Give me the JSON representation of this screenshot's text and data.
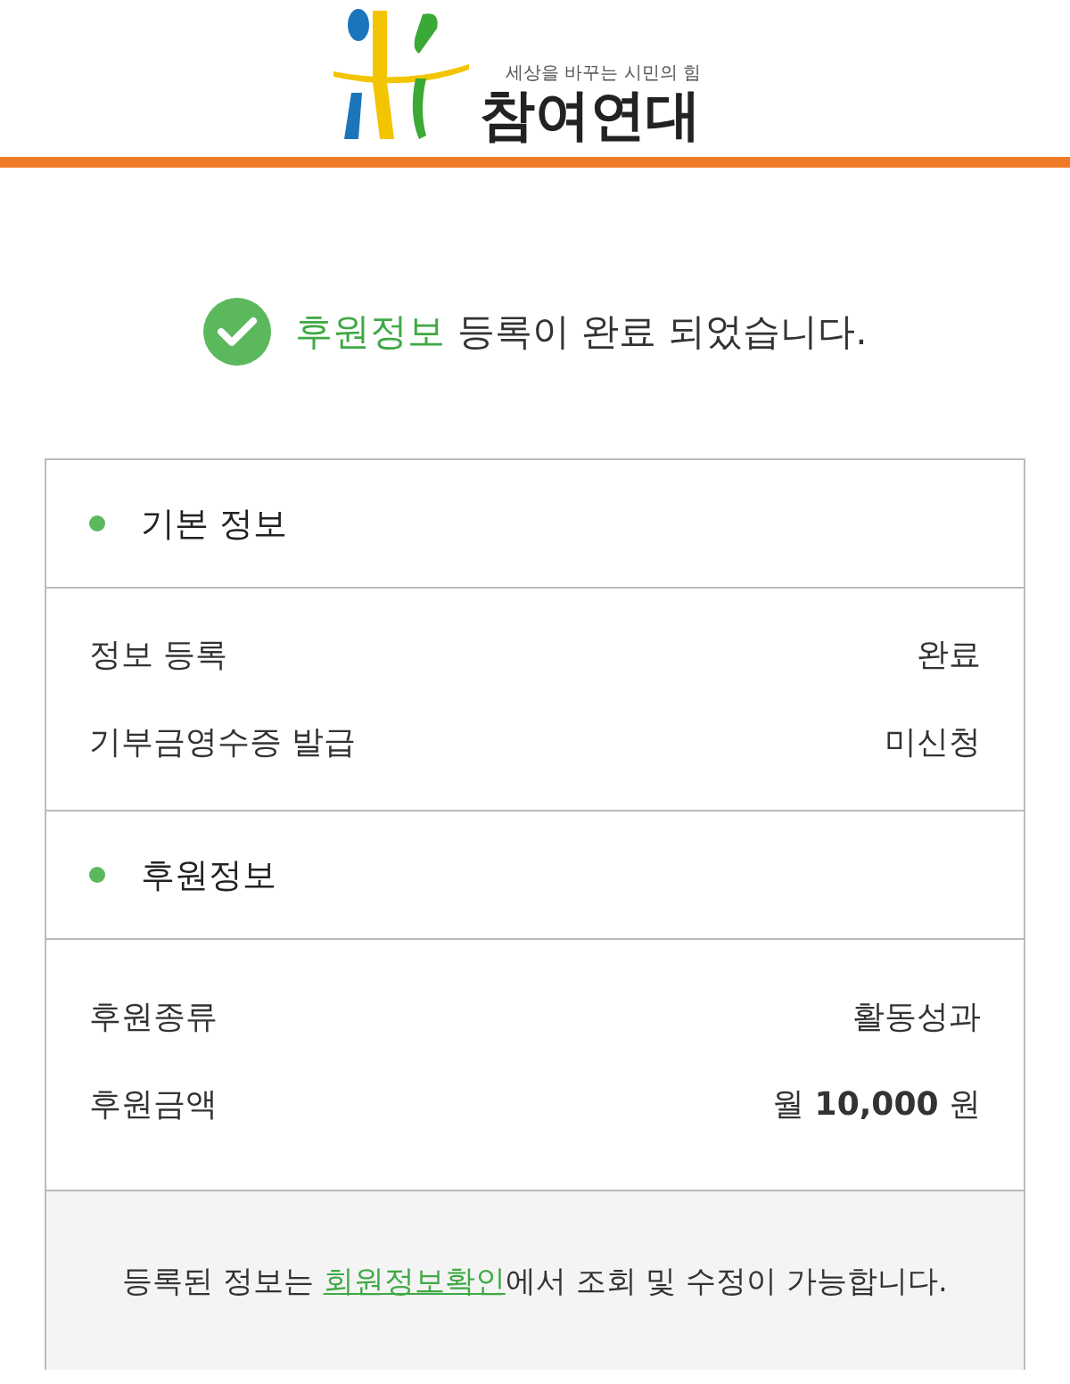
{
  "logo": {
    "tagline": "세상을 바꾸는 시민의 힘",
    "name": "참여연대"
  },
  "message": {
    "highlight": "후원정보",
    "rest": " 등록이 완료 되었습니다."
  },
  "sections": [
    {
      "title": "기본 정보",
      "rows": [
        {
          "label": "정보 등록",
          "value": "완료"
        },
        {
          "label": "기부금영수증 발급",
          "value": "미신청"
        }
      ]
    },
    {
      "title": "후원정보",
      "rows": [
        {
          "label": "후원종류",
          "value": "활동성과"
        },
        {
          "label": "후원금액",
          "value": "월 **10,000** 원"
        }
      ]
    }
  ],
  "notice": {
    "before": "등록된 정보는 ",
    "link": "회원정보확인",
    "after": "에서 조회 및 수정이 가능합니다."
  }
}
